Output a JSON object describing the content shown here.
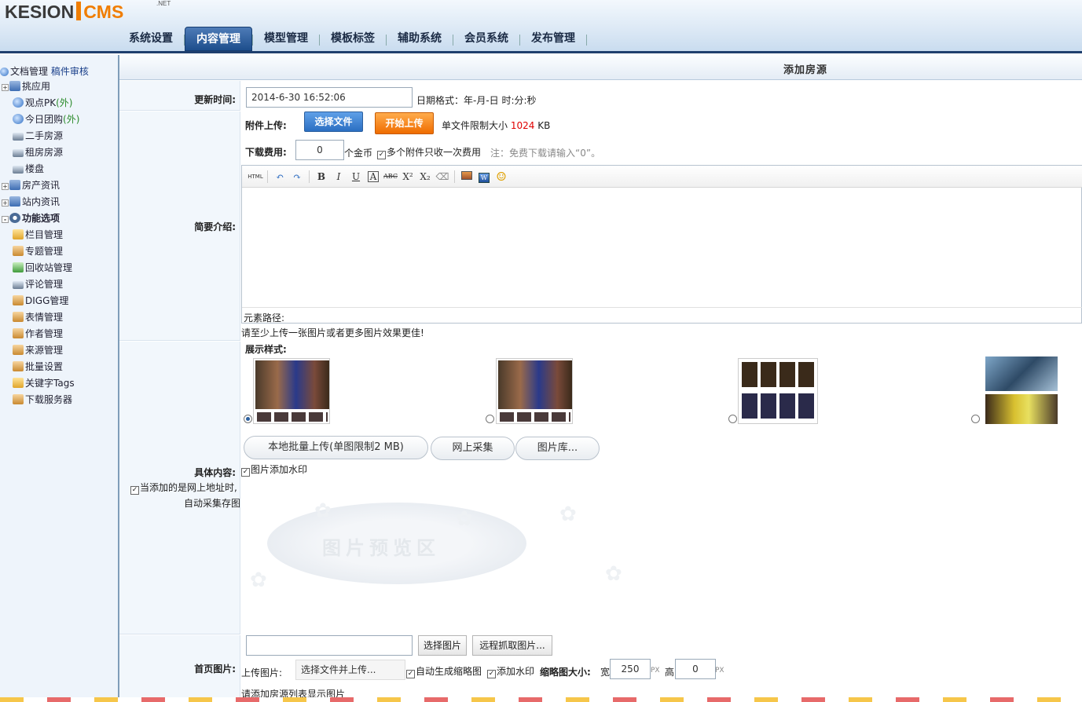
{
  "logo": {
    "text_k": "KESION",
    "text_c": "CMS",
    "net": ".NET"
  },
  "nav": {
    "tabs": [
      {
        "label": "系统设置"
      },
      {
        "label": "内容管理"
      },
      {
        "label": "模型管理"
      },
      {
        "label": "模板标签"
      },
      {
        "label": "辅助系统"
      },
      {
        "label": "会员系统"
      },
      {
        "label": "发布管理"
      }
    ],
    "active": "内容管理"
  },
  "sidebar": {
    "doc_mgmt": "文档管理",
    "review": "稿件审核",
    "items": [
      {
        "label": "挑应用",
        "icon": "folder-app-icon"
      },
      {
        "label": "观点PK",
        "suffix": "(外)",
        "icon": "globe-icon"
      },
      {
        "label": "今日团购",
        "suffix": "(外)",
        "icon": "globe-icon"
      },
      {
        "label": "二手房源",
        "icon": "monitor-icon"
      },
      {
        "label": "租房房源",
        "icon": "monitor-icon"
      },
      {
        "label": "楼盘",
        "icon": "monitor-icon"
      },
      {
        "label": "房产资讯",
        "icon": "folder-app-icon"
      },
      {
        "label": "站内资讯",
        "icon": "folder-app-icon"
      },
      {
        "label": "功能选项",
        "icon": "gear-icon"
      },
      {
        "label": "栏目管理",
        "icon": "folder-icon"
      },
      {
        "label": "专题管理",
        "icon": "topic-icon"
      },
      {
        "label": "回收站管理",
        "icon": "recycle-icon"
      },
      {
        "label": "评论管理",
        "icon": "comment-icon"
      },
      {
        "label": "DIGG管理",
        "icon": "digg-icon"
      },
      {
        "label": "表情管理",
        "icon": "emotion-icon"
      },
      {
        "label": "作者管理",
        "icon": "author-icon"
      },
      {
        "label": "来源管理",
        "icon": "source-icon"
      },
      {
        "label": "批量设置",
        "icon": "batch-icon"
      },
      {
        "label": "关键字Tags",
        "icon": "tags-icon"
      },
      {
        "label": "下载服务器",
        "icon": "download-icon"
      }
    ]
  },
  "page": {
    "title": "添加房源"
  },
  "form": {
    "update_time_label": "更新时间:",
    "update_time_value": "2014-6-30 16:52:06",
    "date_format_hint": "日期格式：年-月-日 时:分:秒",
    "attachment_label": "附件上传:",
    "choose_file": "选择文件",
    "start_upload": "开始上传",
    "file_limit_prefix": "单文件限制大小",
    "file_limit_value": "1024",
    "file_limit_unit": "KB",
    "download_fee_label": "下载费用:",
    "download_fee_value": "0",
    "gold_unit": "个金币",
    "multi_attach_once": "多个附件只收一次费用",
    "free_note": "注：免费下载请输入“0”。",
    "summary_label": "简要介绍:",
    "element_path": "元素路径:",
    "upload_tip": "请至少上传一张图片或者更多图片效果更佳!",
    "display_style_label": "展示样式:",
    "local_batch_upload": "本地批量上传(单图限制2 MB)",
    "online_collect": "网上采集",
    "image_library": "图片库...",
    "watermark": "图片添加水印",
    "content_label": "具体内容:",
    "auto_collect_1": "当添加的是网上地址时,",
    "auto_collect_2": "自动采集存图",
    "preview_area": "图片预览区",
    "home_image_label": "首页图片:",
    "choose_image": "选择图片",
    "remote_fetch": "远程抓取图片...",
    "upload_image_label": "上传图片:",
    "upload_select_placeholder": "选择文件并上传...",
    "auto_thumb": "自动生成缩略图",
    "add_watermark": "添加水印",
    "thumb_size_label": "缩略图大小:",
    "width_label": "宽",
    "width_value": "250",
    "px": "PX",
    "height_label": "高",
    "height_value": "0",
    "list_image_tip": "请添加房源列表显示图片"
  },
  "toolbar": {
    "html": "HTML",
    "bold": "B",
    "italic": "I",
    "underline": "U",
    "fontcolor": "A",
    "strike": "ABC",
    "sup": "X²",
    "sub": "X₂"
  },
  "colors": {
    "accent": "#2b5f9e",
    "orange": "#ef6c00",
    "limit_red": "#e00000"
  }
}
